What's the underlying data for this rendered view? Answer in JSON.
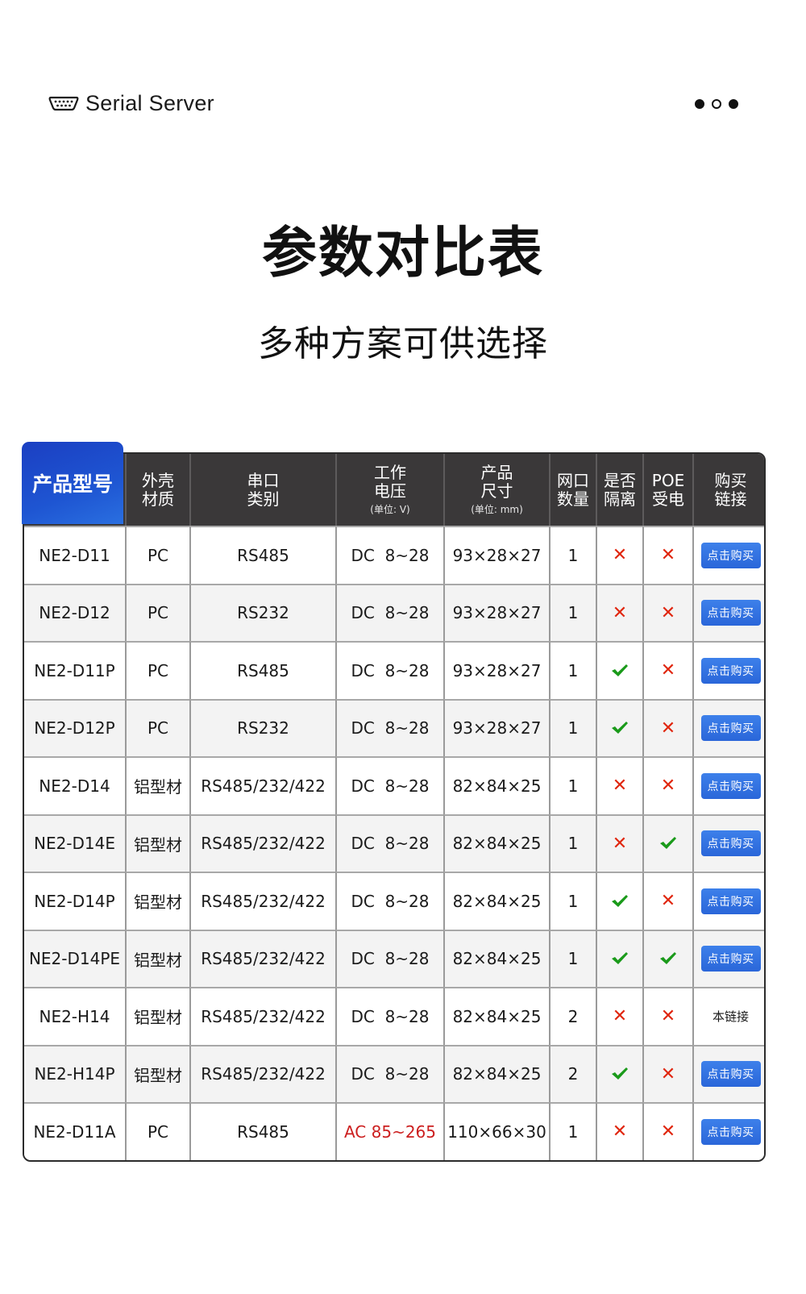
{
  "header": {
    "brand": "Serial Server",
    "brand_icon": "serial-port-icon",
    "dots_icon": "pagination-dots-icon"
  },
  "title": "参数对比表",
  "subtitle": "多种方案可供选择",
  "table": {
    "columns": [
      {
        "key": "model",
        "label": "产品型号"
      },
      {
        "key": "shell",
        "label_lines": [
          "外壳",
          "材质"
        ]
      },
      {
        "key": "serial",
        "label_lines": [
          "串口",
          "类别"
        ]
      },
      {
        "key": "voltage",
        "label_lines": [
          "工作",
          "电压"
        ],
        "unit": "(单位: V)"
      },
      {
        "key": "size",
        "label_lines": [
          "产品",
          "尺寸"
        ],
        "unit": "(单位: mm)"
      },
      {
        "key": "ports",
        "label_lines": [
          "网口",
          "数量"
        ]
      },
      {
        "key": "isolated",
        "label_lines": [
          "是否",
          "隔离"
        ]
      },
      {
        "key": "poe",
        "label_lines": [
          "POE",
          "受电"
        ]
      },
      {
        "key": "buy",
        "label_lines": [
          "购买",
          "链接"
        ]
      }
    ],
    "buy_label": "点击购买",
    "this_link_label": "本链接",
    "colors": {
      "header_bg": "#3a3839",
      "model_tab": "#1e55d2",
      "cross": "#e0260e",
      "check": "#1a9a1a",
      "buy_button": "#2f6fe0",
      "highlight_text": "#cc1f1f"
    },
    "rows": [
      {
        "model": "NE2-D11",
        "shell": "PC",
        "serial": "RS485",
        "voltage": "DC  8~28",
        "size": "93×28×27",
        "ports": "1",
        "isolated": false,
        "poe": false,
        "buy": "button"
      },
      {
        "model": "NE2-D12",
        "shell": "PC",
        "serial": "RS232",
        "voltage": "DC  8~28",
        "size": "93×28×27",
        "ports": "1",
        "isolated": false,
        "poe": false,
        "buy": "button"
      },
      {
        "model": "NE2-D11P",
        "shell": "PC",
        "serial": "RS485",
        "voltage": "DC  8~28",
        "size": "93×28×27",
        "ports": "1",
        "isolated": true,
        "poe": false,
        "buy": "button"
      },
      {
        "model": "NE2-D12P",
        "shell": "PC",
        "serial": "RS232",
        "voltage": "DC  8~28",
        "size": "93×28×27",
        "ports": "1",
        "isolated": true,
        "poe": false,
        "buy": "button"
      },
      {
        "model": "NE2-D14",
        "shell": "铝型材",
        "serial": "RS485/232/422",
        "voltage": "DC  8~28",
        "size": "82×84×25",
        "ports": "1",
        "isolated": false,
        "poe": false,
        "buy": "button"
      },
      {
        "model": "NE2-D14E",
        "shell": "铝型材",
        "serial": "RS485/232/422",
        "voltage": "DC  8~28",
        "size": "82×84×25",
        "ports": "1",
        "isolated": false,
        "poe": true,
        "buy": "button"
      },
      {
        "model": "NE2-D14P",
        "shell": "铝型材",
        "serial": "RS485/232/422",
        "voltage": "DC  8~28",
        "size": "82×84×25",
        "ports": "1",
        "isolated": true,
        "poe": false,
        "buy": "button"
      },
      {
        "model": "NE2-D14PE",
        "shell": "铝型材",
        "serial": "RS485/232/422",
        "voltage": "DC  8~28",
        "size": "82×84×25",
        "ports": "1",
        "isolated": true,
        "poe": true,
        "buy": "button"
      },
      {
        "model": "NE2-H14",
        "shell": "铝型材",
        "serial": "RS485/232/422",
        "voltage": "DC  8~28",
        "size": "82×84×25",
        "ports": "2",
        "isolated": false,
        "poe": false,
        "buy": "this"
      },
      {
        "model": "NE2-H14P",
        "shell": "铝型材",
        "serial": "RS485/232/422",
        "voltage": "DC  8~28",
        "size": "82×84×25",
        "ports": "2",
        "isolated": true,
        "poe": false,
        "buy": "button"
      },
      {
        "model": "NE2-D11A",
        "shell": "PC",
        "serial": "RS485",
        "voltage": "AC 85~265",
        "voltage_highlight": true,
        "size": "110×66×30",
        "ports": "1",
        "isolated": false,
        "poe": false,
        "buy": "button"
      }
    ]
  }
}
